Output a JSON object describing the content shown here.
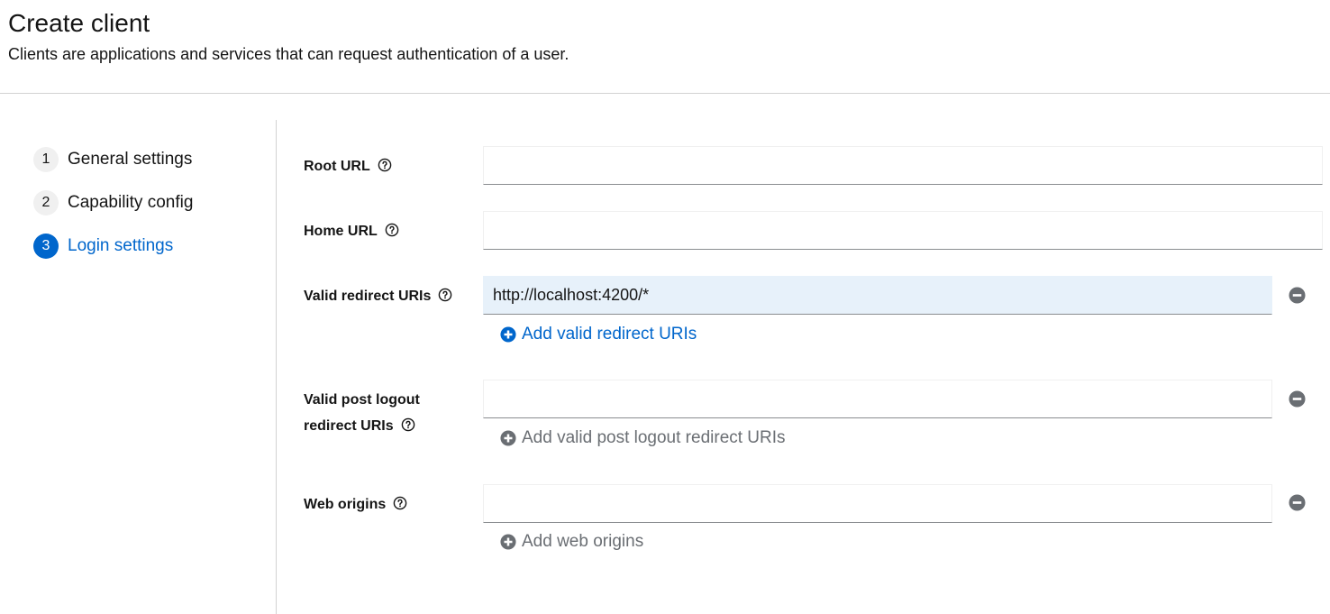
{
  "header": {
    "title": "Create client",
    "subtitle": "Clients are applications and services that can request authentication of a user."
  },
  "wizard": {
    "steps": [
      {
        "number": "1",
        "label": "General settings"
      },
      {
        "number": "2",
        "label": "Capability config"
      },
      {
        "number": "3",
        "label": "Login settings"
      }
    ],
    "current_step": "3"
  },
  "form": {
    "root_url": {
      "label": "Root URL",
      "value": ""
    },
    "home_url": {
      "label": "Home URL",
      "value": ""
    },
    "valid_redirect_uris": {
      "label": "Valid redirect URIs",
      "value": "http://localhost:4200/*",
      "add_label": "Add valid redirect URIs"
    },
    "valid_post_logout": {
      "label_line1": "Valid post logout",
      "label_line2": "redirect URIs",
      "value": "",
      "add_label": "Add valid post logout redirect URIs"
    },
    "web_origins": {
      "label": "Web origins",
      "value": "",
      "add_label": "Add web origins"
    }
  },
  "icons": {
    "help": "help-icon",
    "remove": "minus-circle-icon",
    "add": "plus-circle-icon"
  },
  "colors": {
    "accent": "#0066cc",
    "filled_input_bg": "#e7f1fa",
    "muted_text": "#6a6e73",
    "remove_icon": "#6a6e73"
  }
}
